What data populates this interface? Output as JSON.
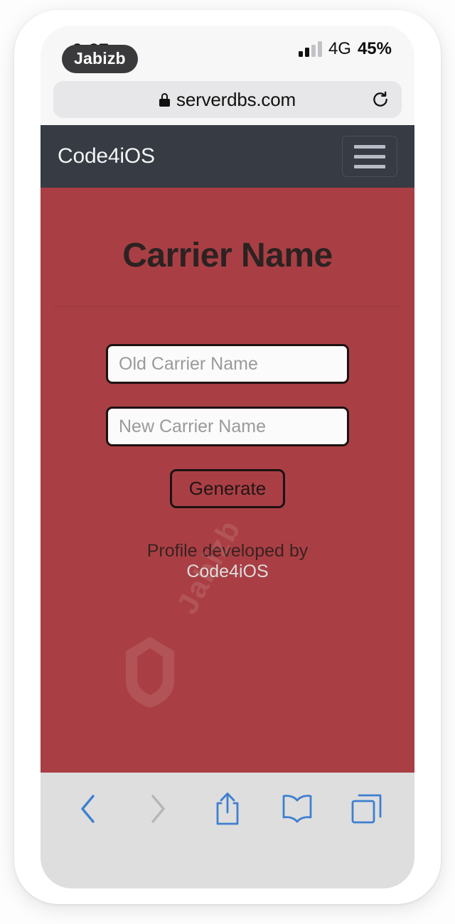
{
  "status_bar": {
    "time": "9:27",
    "watermark_badge": "Jabizb",
    "network": "4G",
    "battery": "45%",
    "signal_bars_filled": 2,
    "signal_bars_total": 4
  },
  "browser": {
    "url": "serverdbs.com",
    "lock_icon": "lock-icon",
    "reload_icon": "reload-icon",
    "toolbar": {
      "back_label": "back-chevron-icon",
      "forward_label": "forward-chevron-icon",
      "share_label": "share-icon",
      "bookmarks_label": "bookmarks-book-icon",
      "tabs_label": "tabs-icon"
    }
  },
  "page": {
    "navbar": {
      "brand": "Code4iOS",
      "menu_icon": "hamburger-menu-icon"
    },
    "heading": "Carrier Name",
    "fields": [
      {
        "name": "old-carrier-name",
        "placeholder": "Old Carrier Name",
        "value": ""
      },
      {
        "name": "new-carrier-name",
        "placeholder": "New Carrier Name",
        "value": ""
      }
    ],
    "generate_button": "Generate",
    "footer_prefix": "Profile developed by ",
    "footer_link": "Code4iOS",
    "watermark": "Jabizb"
  },
  "colors": {
    "page_background": "#a93f44",
    "navbar": "#363b44",
    "heading_text": "#2c2222",
    "field_border": "#1d1212",
    "footer_link": "#dcdcdc",
    "toolbar_blue": "#3f7fd0",
    "gray_band": "#828282",
    "browser_chrome": "#f7f7f8"
  }
}
